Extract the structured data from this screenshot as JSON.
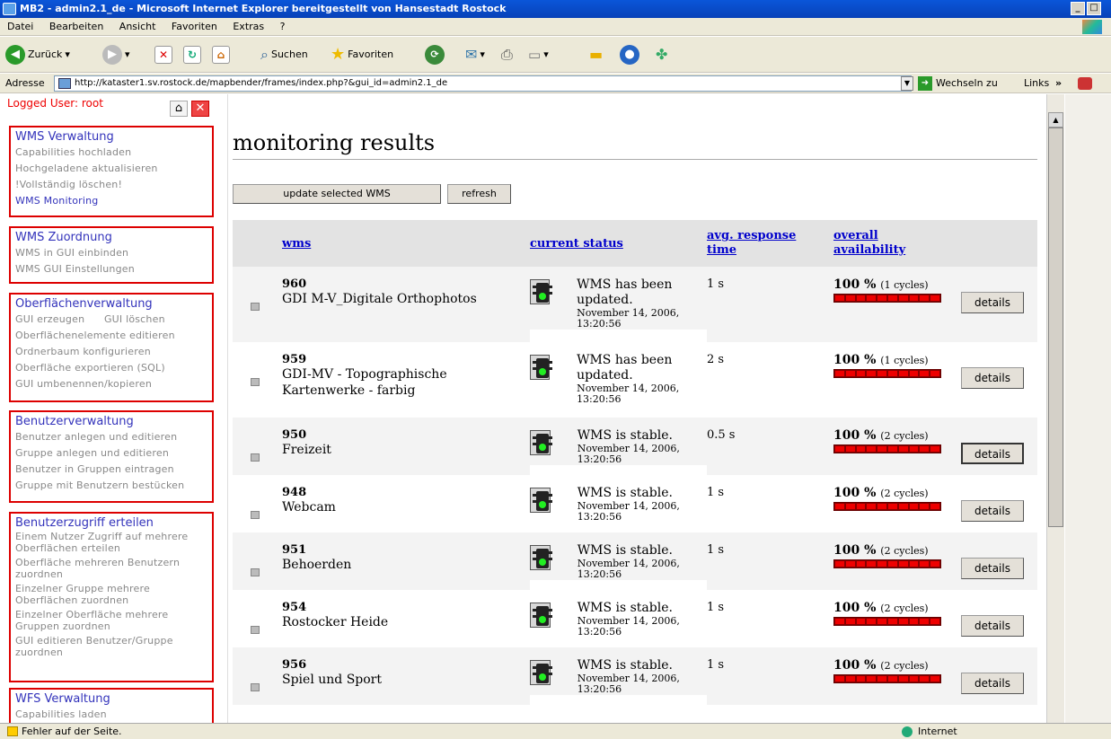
{
  "window": {
    "title": "MB2 - admin2.1_de - Microsoft Internet Explorer bereitgestellt von Hansestadt Rostock"
  },
  "menu": [
    "Datei",
    "Bearbeiten",
    "Ansicht",
    "Favoriten",
    "Extras",
    "?"
  ],
  "toolbar": {
    "back": "Zurück",
    "search": "Suchen",
    "favorites": "Favoriten"
  },
  "address": {
    "label": "Adresse",
    "url": "http://kataster1.sv.rostock.de/mapbender/frames/index.php?&gui_id=admin2.1_de",
    "go": "Wechseln zu",
    "links": "Links"
  },
  "sidebar": {
    "logged_user": "Logged User: root",
    "groups": [
      {
        "title": "WMS Verwaltung",
        "items": [
          "Capabilities hochladen",
          "Hochgeladene aktualisieren",
          "!Vollständig löschen!",
          "WMS Monitoring"
        ]
      },
      {
        "title": "WMS Zuordnung",
        "items": [
          "WMS in GUI einbinden",
          "WMS GUI Einstellungen"
        ]
      },
      {
        "title": "Oberflächenverwaltung",
        "items": [
          "GUI erzeugen",
          "GUI löschen",
          "Oberflächenelemente editieren",
          "Ordnerbaum konfigurieren",
          "Oberfläche exportieren (SQL)",
          "GUI umbenennen/kopieren"
        ]
      },
      {
        "title": "Benutzerverwaltung",
        "items": [
          "Benutzer anlegen und editieren",
          "Gruppe anlegen und editieren",
          "Benutzer in Gruppen eintragen",
          "Gruppe mit Benutzern bestücken"
        ]
      },
      {
        "title": "Benutzerzugriff erteilen",
        "items": [
          "Einem Nutzer Zugriff auf mehrere Oberflächen erteilen",
          "Oberfläche mehreren Benutzern zuordnen",
          "Einzelner Gruppe mehrere Oberflächen zuordnen",
          "Einzelner Oberfläche mehrere Gruppen zuordnen",
          "GUI editieren Benutzer/Gruppe zuordnen"
        ]
      },
      {
        "title": "WFS Verwaltung",
        "items": [
          "Capabilities laden"
        ]
      }
    ]
  },
  "main": {
    "title": "monitoring results",
    "update_button": "update selected WMS",
    "refresh_button": "refresh",
    "columns": {
      "wms": "wms",
      "status": "current status",
      "response_1": "avg. response",
      "response_2": "time",
      "avail_1": "overall",
      "avail_2": "availability"
    },
    "details_label": "details",
    "rows": [
      {
        "id": "960",
        "name": "GDI M-V_Digitale Orthophotos",
        "status": "WMS has been updated.",
        "date": "November 14, 2006, 13:20:56",
        "response": "1 s",
        "availability": "100 %",
        "cycles": "(1 cycles)"
      },
      {
        "id": "959",
        "name": "GDI-MV - Topographische Kartenwerke - farbig",
        "status": "WMS has been updated.",
        "date": "November 14, 2006, 13:20:56",
        "response": "2 s",
        "availability": "100 %",
        "cycles": "(1 cycles)"
      },
      {
        "id": "950",
        "name": "Freizeit",
        "status": "WMS is stable.",
        "date": "November 14, 2006, 13:20:56",
        "response": "0.5 s",
        "availability": "100 %",
        "cycles": "(2 cycles)"
      },
      {
        "id": "948",
        "name": "Webcam",
        "status": "WMS is stable.",
        "date": "November 14, 2006, 13:20:56",
        "response": "1 s",
        "availability": "100 %",
        "cycles": "(2 cycles)"
      },
      {
        "id": "951",
        "name": "Behoerden",
        "status": "WMS is stable.",
        "date": "November 14, 2006, 13:20:56",
        "response": "1 s",
        "availability": "100 %",
        "cycles": "(2 cycles)"
      },
      {
        "id": "954",
        "name": "Rostocker Heide",
        "status": "WMS is stable.",
        "date": "November 14, 2006, 13:20:56",
        "response": "1 s",
        "availability": "100 %",
        "cycles": "(2 cycles)"
      },
      {
        "id": "956",
        "name": "Spiel und Sport",
        "status": "WMS is stable.",
        "date": "November 14, 2006, 13:20:56",
        "response": "1 s",
        "availability": "100 %",
        "cycles": "(2 cycles)"
      }
    ]
  },
  "statusbar": {
    "left": "Fehler auf der Seite.",
    "zone": "Internet"
  }
}
